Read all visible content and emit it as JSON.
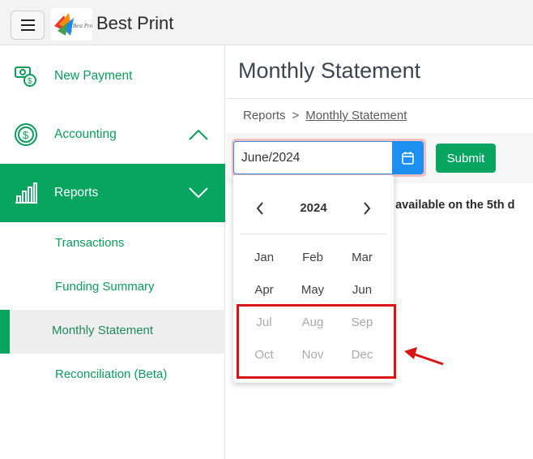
{
  "header": {
    "app_title": "Best Print",
    "logo_text": "Best Print"
  },
  "sidebar": {
    "items": [
      {
        "label": "New Payment",
        "icon": "money-icon"
      },
      {
        "label": "Accounting",
        "icon": "dollar-circle-icon",
        "expanded": false
      },
      {
        "label": "Reports",
        "icon": "bar-chart-icon",
        "expanded": true,
        "active": true
      }
    ],
    "sub_items": [
      {
        "label": "Transactions"
      },
      {
        "label": "Funding Summary"
      },
      {
        "label": "Monthly Statement",
        "active": true
      },
      {
        "label": "Reconciliation (Beta)"
      }
    ]
  },
  "main": {
    "title": "Monthly Statement",
    "breadcrumb": {
      "root": "Reports",
      "separator": ">",
      "current": "Monthly Statement"
    },
    "date_value": "June/2024",
    "submit_label": "Submit",
    "notice_text": "s available on the 5th d"
  },
  "month_picker": {
    "year": "2024",
    "months": [
      {
        "label": "Jan",
        "enabled": true
      },
      {
        "label": "Feb",
        "enabled": true
      },
      {
        "label": "Mar",
        "enabled": true
      },
      {
        "label": "Apr",
        "enabled": true
      },
      {
        "label": "May",
        "enabled": true
      },
      {
        "label": "Jun",
        "enabled": true
      },
      {
        "label": "Jul",
        "enabled": false
      },
      {
        "label": "Aug",
        "enabled": false
      },
      {
        "label": "Sep",
        "enabled": false
      },
      {
        "label": "Oct",
        "enabled": false
      },
      {
        "label": "Nov",
        "enabled": false
      },
      {
        "label": "Dec",
        "enabled": false
      }
    ]
  },
  "colors": {
    "brand_green": "#07a560",
    "accent_blue": "#1d8ff0",
    "annotation_red": "#d81414"
  }
}
